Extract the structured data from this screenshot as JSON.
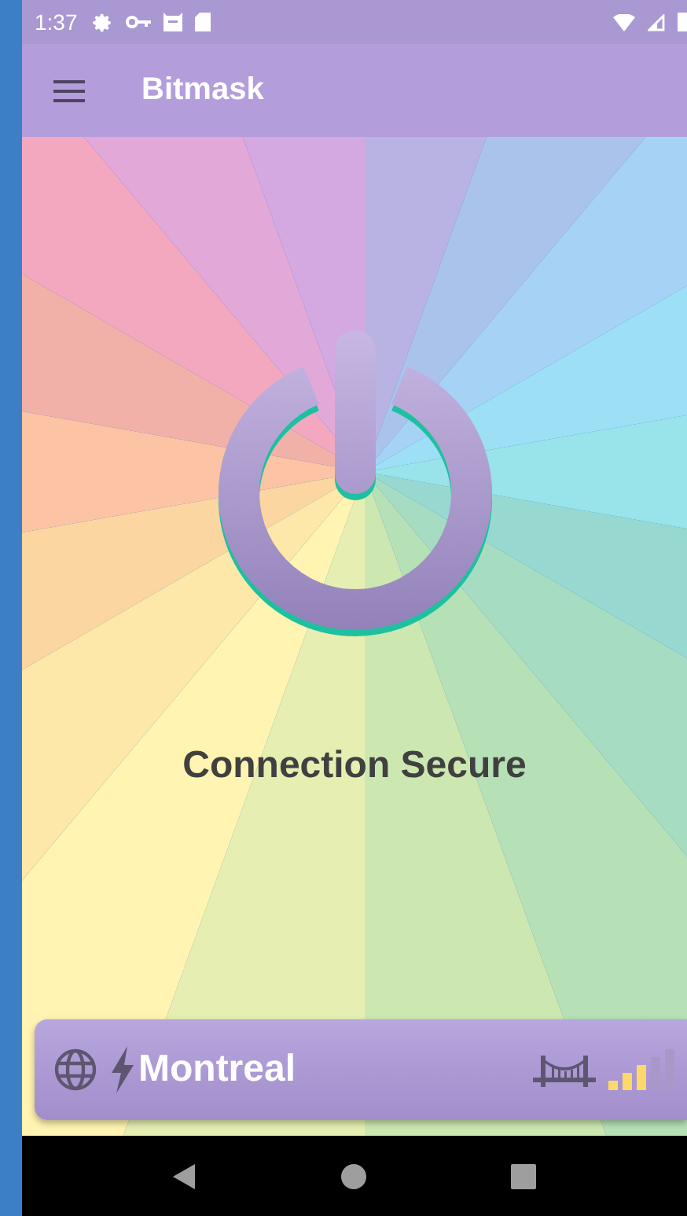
{
  "status_bar": {
    "time": "1:37"
  },
  "app_bar": {
    "title": "Bitmask"
  },
  "vpn": {
    "status": "Connection Secure",
    "connected": true
  },
  "location_bar": {
    "location": "Montreal"
  }
}
